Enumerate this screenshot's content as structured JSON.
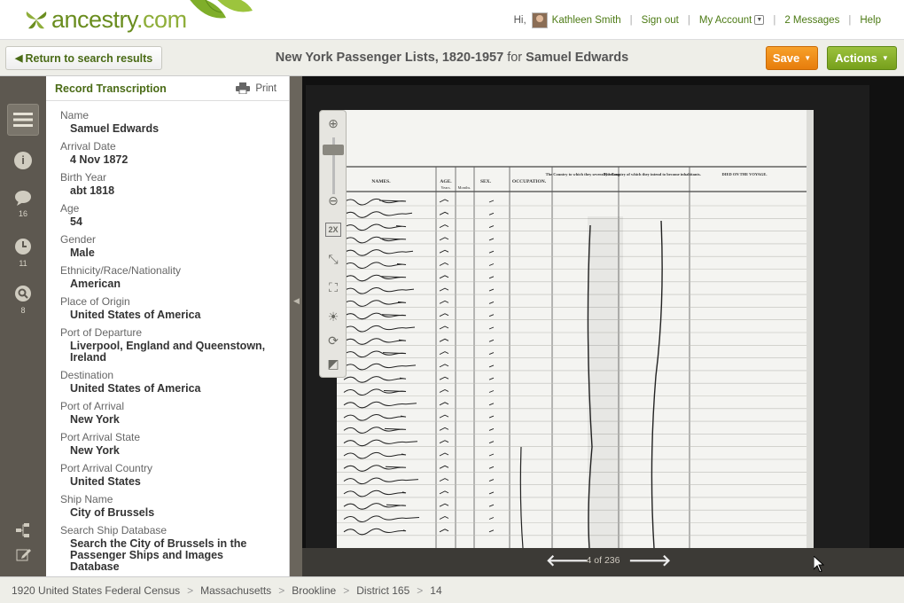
{
  "brand": {
    "name": "ancestry",
    "suffix": ".com"
  },
  "user": {
    "greeting": "Hi,",
    "name": "Kathleen Smith",
    "sign_out": "Sign out",
    "my_account": "My Account",
    "messages": "2 Messages",
    "help": "Help"
  },
  "titlebar": {
    "return_label": "Return to search results",
    "collection": "New York Passenger Lists, 1820-1957",
    "for_word": "for",
    "person": "Samuel Edwards",
    "save_label": "Save",
    "actions_label": "Actions"
  },
  "rail": {
    "comments_count": "16",
    "history_count": "11",
    "search_count": "8"
  },
  "panel": {
    "title": "Record Transcription",
    "print_label": "Print",
    "fields": [
      {
        "label": "Name",
        "value": "Samuel Edwards"
      },
      {
        "label": "Arrival Date",
        "value": "4 Nov 1872"
      },
      {
        "label": "Birth Year",
        "value": "abt 1818"
      },
      {
        "label": "Age",
        "value": "54"
      },
      {
        "label": "Gender",
        "value": "Male"
      },
      {
        "label": "Ethnicity/Race/Nationality",
        "value": "American"
      },
      {
        "label": "Place of Origin",
        "value": "United States of America"
      },
      {
        "label": "Port of Departure",
        "value": "Liverpool, England and Queenstown, Ireland"
      },
      {
        "label": "Destination",
        "value": "United States of America"
      },
      {
        "label": "Port of Arrival",
        "value": "New York"
      },
      {
        "label": "Port Arrival State",
        "value": "New York"
      },
      {
        "label": "Port Arrival Country",
        "value": "United States"
      },
      {
        "label": "Ship Name",
        "value": "City of Brussels"
      },
      {
        "label": "Search Ship Database",
        "value": "Search the City of Brussels in the Passenger Ships and Images Database"
      }
    ]
  },
  "viewer": {
    "pager": "4 of 236",
    "doc_headers": [
      "NAMES.",
      "AGE.",
      "SEX.",
      "OCCUPATION.",
      "The Country to which they severally belong.",
      "The Country of which they intend to become inhabitants.",
      "DIED ON THE VOYAGE."
    ],
    "age_sub": [
      "Years.",
      "Months."
    ],
    "zoom_label": "2X"
  },
  "breadcrumb": [
    "1920 United States Federal Census",
    "Massachusetts",
    "Brookline",
    "District 165",
    "14"
  ]
}
